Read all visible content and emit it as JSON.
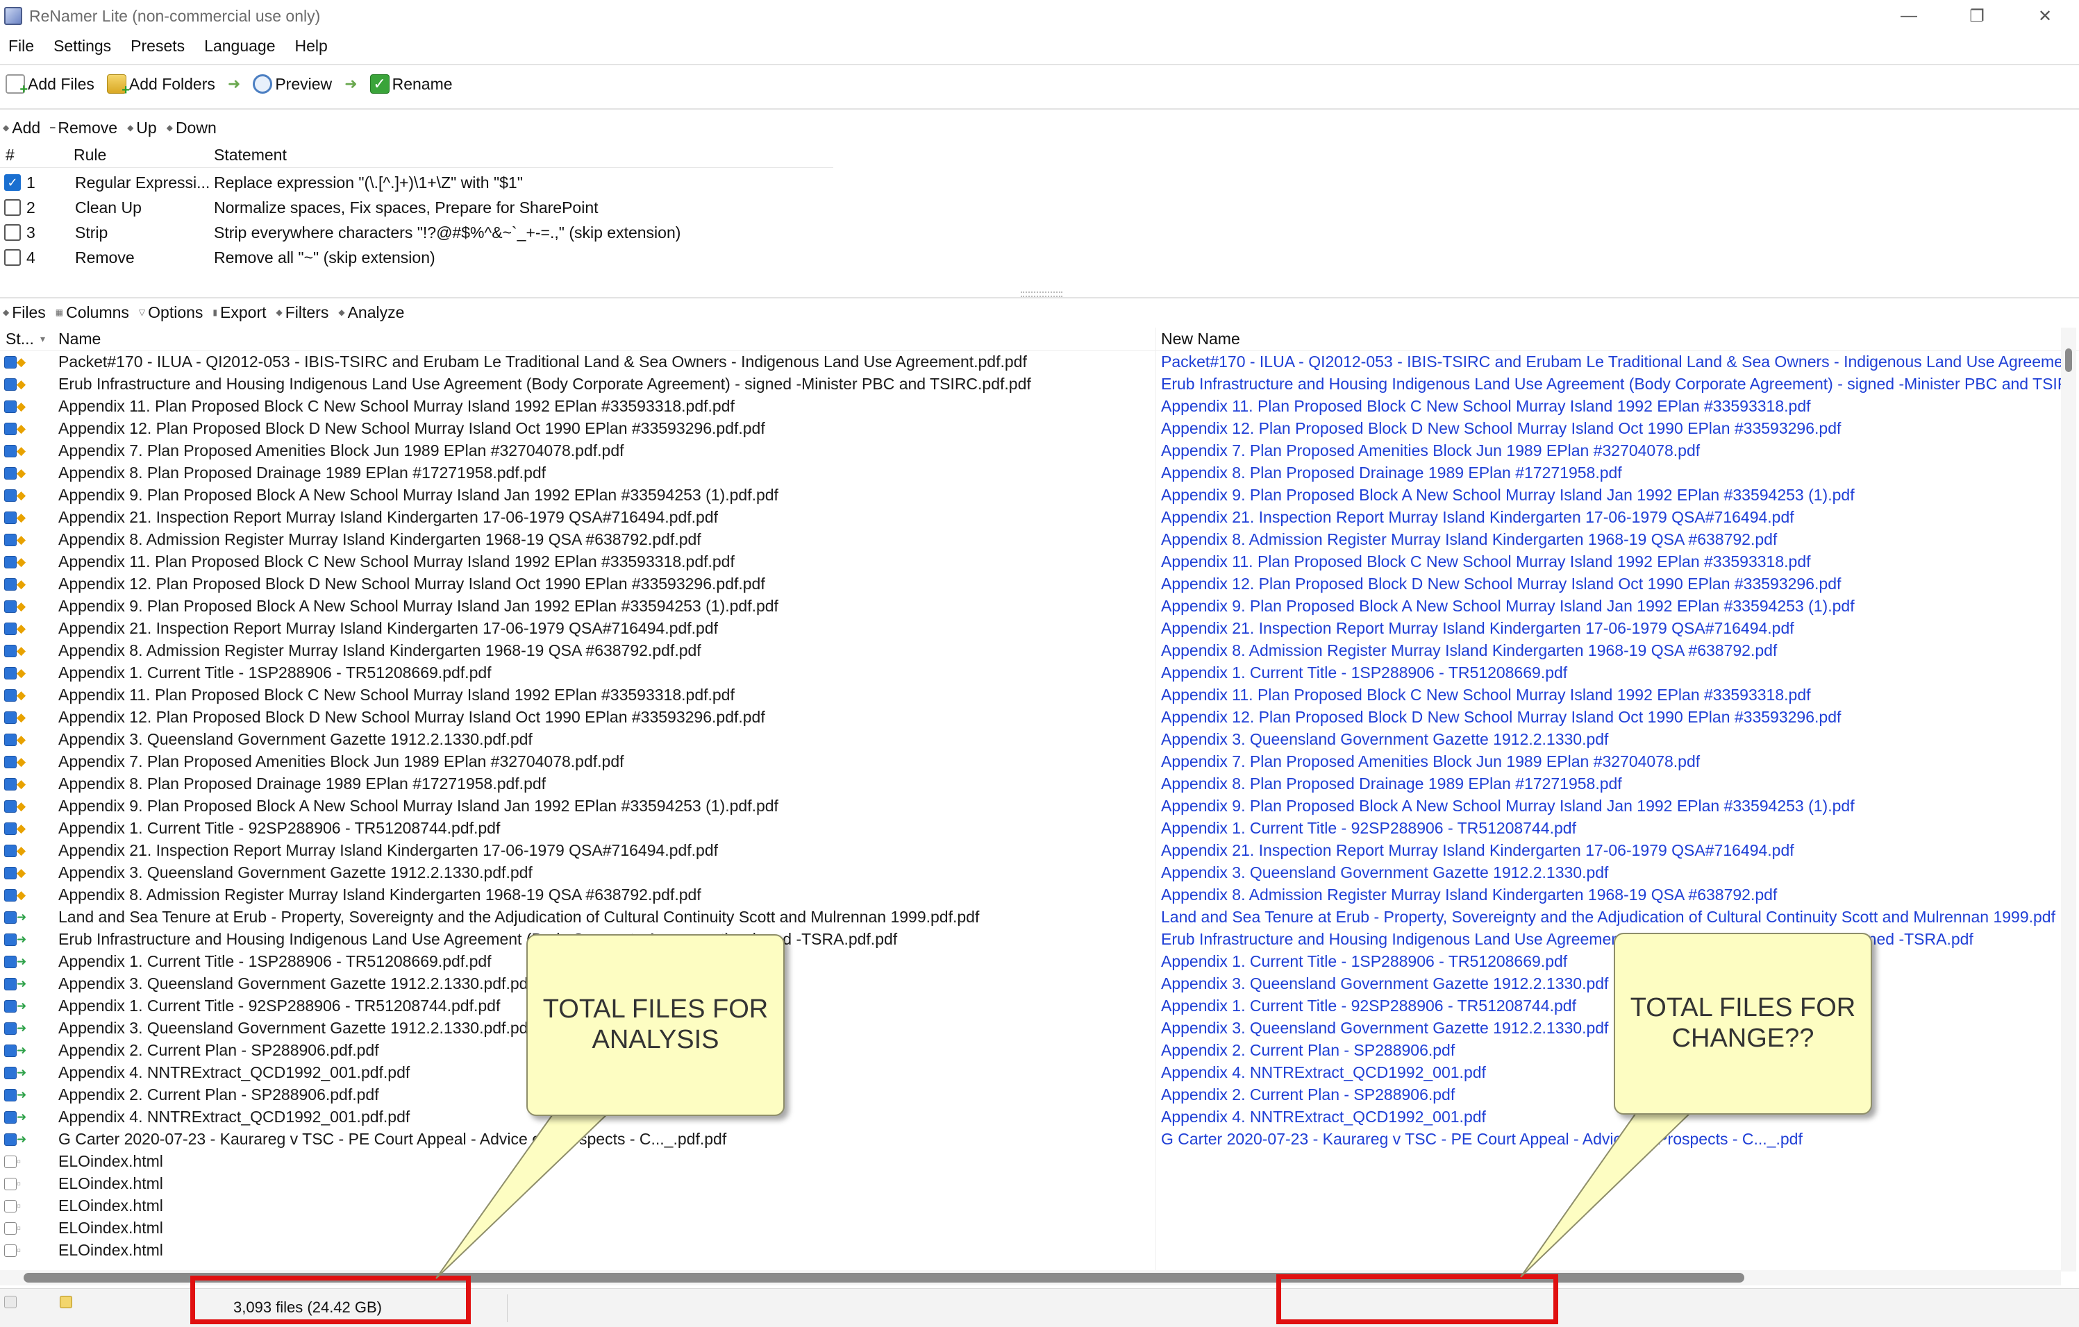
{
  "window": {
    "title": "ReNamer Lite (non-commercial use only)",
    "controls": [
      "—",
      "❐",
      "✕"
    ]
  },
  "menu": [
    "File",
    "Settings",
    "Presets",
    "Language",
    "Help"
  ],
  "toolbar": {
    "add_files": "Add Files",
    "add_folders": "Add Folders",
    "preview": "Preview",
    "rename": "Rename"
  },
  "rules_tools": [
    "Add",
    "Remove",
    "Up",
    "Down"
  ],
  "rules_header": {
    "num": "#",
    "rule": "Rule",
    "statement": "Statement"
  },
  "rules": [
    {
      "checked": true,
      "num": "1",
      "rule": "Regular Expressi...",
      "statement": "Replace expression \"(\\.[^.]+)\\1+\\Z\" with \"$1\""
    },
    {
      "checked": false,
      "num": "2",
      "rule": "Clean Up",
      "statement": "Normalize spaces, Fix spaces, Prepare for SharePoint"
    },
    {
      "checked": false,
      "num": "3",
      "rule": "Strip",
      "statement": "Strip everywhere characters \"!?@#$%^&~`_+-=.,\" (skip extension)"
    },
    {
      "checked": false,
      "num": "4",
      "rule": "Remove",
      "statement": "Remove all \"~\" (skip extension)"
    }
  ],
  "files_tools": [
    "Files",
    "Columns",
    "Options",
    "Export",
    "Filters",
    "Analyze"
  ],
  "grid_header": {
    "state": "St...",
    "name": "Name",
    "new_name": "New Name"
  },
  "files": [
    {
      "s": "c",
      "b": "diamond",
      "name": "Packet#170 - ILUA - QI2012-053 - IBIS-TSIRC and Erubam Le Traditional Land & Sea Owners - Indigenous Land Use Agreement.pdf.pdf",
      "new": "Packet#170 - ILUA - QI2012-053 - IBIS-TSIRC and Erubam Le Traditional Land & Sea Owners - Indigenous Land Use Agreement.pdf"
    },
    {
      "s": "c",
      "b": "diamond",
      "name": "Erub Infrastructure and Housing Indigenous Land Use Agreement (Body Corporate Agreement) - signed -Minister PBC and TSIRC.pdf.pdf",
      "new": "Erub Infrastructure and Housing Indigenous Land Use Agreement (Body Corporate Agreement) - signed -Minister PBC and TSIRC.pdf"
    },
    {
      "s": "c",
      "b": "diamond",
      "name": "Appendix 11. Plan Proposed Block C New School Murray Island 1992 EPlan #33593318.pdf.pdf",
      "new": "Appendix 11. Plan Proposed Block C New School Murray Island 1992 EPlan #33593318.pdf"
    },
    {
      "s": "c",
      "b": "diamond",
      "name": "Appendix 12. Plan Proposed Block D New School Murray Island Oct 1990 EPlan #33593296.pdf.pdf",
      "new": "Appendix 12. Plan Proposed Block D New School Murray Island Oct 1990 EPlan #33593296.pdf"
    },
    {
      "s": "c",
      "b": "diamond",
      "name": "Appendix 7. Plan Proposed Amenities Block Jun 1989 EPlan #32704078.pdf.pdf",
      "new": "Appendix 7. Plan Proposed Amenities Block Jun 1989 EPlan #32704078.pdf"
    },
    {
      "s": "c",
      "b": "diamond",
      "name": "Appendix 8. Plan Proposed Drainage 1989 EPlan #17271958.pdf.pdf",
      "new": "Appendix 8. Plan Proposed Drainage 1989 EPlan #17271958.pdf"
    },
    {
      "s": "c",
      "b": "diamond",
      "name": "Appendix 9. Plan Proposed Block A New School Murray Island Jan 1992 EPlan #33594253 (1).pdf.pdf",
      "new": "Appendix 9. Plan Proposed Block A New School Murray Island Jan 1992 EPlan #33594253 (1).pdf"
    },
    {
      "s": "c",
      "b": "diamond",
      "name": "Appendix 21. Inspection Report Murray Island Kindergarten 17-06-1979 QSA#716494.pdf.pdf",
      "new": "Appendix 21. Inspection Report Murray Island Kindergarten 17-06-1979 QSA#716494.pdf"
    },
    {
      "s": "c",
      "b": "diamond",
      "name": "Appendix 8. Admission Register Murray Island Kindergarten 1968-19 QSA #638792.pdf.pdf",
      "new": "Appendix 8. Admission Register Murray Island Kindergarten 1968-19 QSA #638792.pdf"
    },
    {
      "s": "c",
      "b": "diamond",
      "name": "Appendix 11. Plan Proposed Block C New School Murray Island 1992 EPlan #33593318.pdf.pdf",
      "new": "Appendix 11. Plan Proposed Block C New School Murray Island 1992 EPlan #33593318.pdf"
    },
    {
      "s": "c",
      "b": "diamond",
      "name": "Appendix 12. Plan Proposed Block D New School Murray Island Oct 1990 EPlan #33593296.pdf.pdf",
      "new": "Appendix 12. Plan Proposed Block D New School Murray Island Oct 1990 EPlan #33593296.pdf"
    },
    {
      "s": "c",
      "b": "diamond",
      "name": "Appendix 9. Plan Proposed Block A New School Murray Island Jan 1992 EPlan #33594253 (1).pdf.pdf",
      "new": "Appendix 9. Plan Proposed Block A New School Murray Island Jan 1992 EPlan #33594253 (1).pdf"
    },
    {
      "s": "c",
      "b": "diamond",
      "name": "Appendix 21. Inspection Report Murray Island Kindergarten 17-06-1979 QSA#716494.pdf.pdf",
      "new": "Appendix 21. Inspection Report Murray Island Kindergarten 17-06-1979 QSA#716494.pdf"
    },
    {
      "s": "c",
      "b": "diamond",
      "name": "Appendix 8. Admission Register Murray Island Kindergarten 1968-19 QSA #638792.pdf.pdf",
      "new": "Appendix 8. Admission Register Murray Island Kindergarten 1968-19 QSA #638792.pdf"
    },
    {
      "s": "c",
      "b": "diamond",
      "name": "Appendix 1. Current Title - 1SP288906 - TR51208669.pdf.pdf",
      "new": "Appendix 1. Current Title - 1SP288906 - TR51208669.pdf"
    },
    {
      "s": "c",
      "b": "diamond",
      "name": "Appendix 11. Plan Proposed Block C New School Murray Island 1992 EPlan #33593318.pdf.pdf",
      "new": "Appendix 11. Plan Proposed Block C New School Murray Island 1992 EPlan #33593318.pdf"
    },
    {
      "s": "c",
      "b": "diamond",
      "name": "Appendix 12. Plan Proposed Block D New School Murray Island Oct 1990 EPlan #33593296.pdf.pdf",
      "new": "Appendix 12. Plan Proposed Block D New School Murray Island Oct 1990 EPlan #33593296.pdf"
    },
    {
      "s": "c",
      "b": "diamond",
      "name": "Appendix 3. Queensland Government Gazette 1912.2.1330.pdf.pdf",
      "new": "Appendix 3. Queensland Government Gazette 1912.2.1330.pdf"
    },
    {
      "s": "c",
      "b": "diamond",
      "name": "Appendix 7. Plan Proposed Amenities Block Jun 1989 EPlan #32704078.pdf.pdf",
      "new": "Appendix 7. Plan Proposed Amenities Block Jun 1989 EPlan #32704078.pdf"
    },
    {
      "s": "c",
      "b": "diamond",
      "name": "Appendix 8. Plan Proposed Drainage 1989 EPlan #17271958.pdf.pdf",
      "new": "Appendix 8. Plan Proposed Drainage 1989 EPlan #17271958.pdf"
    },
    {
      "s": "c",
      "b": "diamond",
      "name": "Appendix 9. Plan Proposed Block A New School Murray Island Jan 1992 EPlan #33594253 (1).pdf.pdf",
      "new": "Appendix 9. Plan Proposed Block A New School Murray Island Jan 1992 EPlan #33594253 (1).pdf"
    },
    {
      "s": "c",
      "b": "diamond",
      "name": "Appendix 1. Current Title - 92SP288906 - TR51208744.pdf.pdf",
      "new": "Appendix 1. Current Title - 92SP288906 - TR51208744.pdf"
    },
    {
      "s": "c",
      "b": "diamond",
      "name": "Appendix 21. Inspection Report Murray Island Kindergarten 17-06-1979 QSA#716494.pdf.pdf",
      "new": "Appendix 21. Inspection Report Murray Island Kindergarten 17-06-1979 QSA#716494.pdf"
    },
    {
      "s": "c",
      "b": "diamond",
      "name": "Appendix 3. Queensland Government Gazette 1912.2.1330.pdf.pdf",
      "new": "Appendix 3. Queensland Government Gazette 1912.2.1330.pdf"
    },
    {
      "s": "c",
      "b": "diamond",
      "name": "Appendix 8. Admission Register Murray Island Kindergarten 1968-19 QSA #638792.pdf.pdf",
      "new": "Appendix 8. Admission Register Murray Island Kindergarten 1968-19 QSA #638792.pdf"
    },
    {
      "s": "c",
      "b": "arrow",
      "name": "Land and Sea Tenure at Erub - Property, Sovereignty and the Adjudication of Cultural Continuity Scott and Mulrennan 1999.pdf.pdf",
      "new": "Land and Sea Tenure at Erub - Property, Sovereignty and the Adjudication of Cultural Continuity Scott and Mulrennan 1999.pdf"
    },
    {
      "s": "c",
      "b": "arrow",
      "name": "Erub Infrastructure and Housing Indigenous Land Use Agreement (Body Corporate Agreement) - signed -TSRA.pdf.pdf",
      "new": "Erub Infrastructure and Housing Indigenous Land Use Agreement (Body Corporate Agreement) - signed -TSRA.pdf"
    },
    {
      "s": "c",
      "b": "arrow",
      "name": "Appendix 1. Current Title - 1SP288906 - TR51208669.pdf.pdf",
      "new": "Appendix 1. Current Title - 1SP288906 - TR51208669.pdf"
    },
    {
      "s": "c",
      "b": "arrow",
      "name": "Appendix 3. Queensland Government Gazette 1912.2.1330.pdf.pdf",
      "new": "Appendix 3. Queensland Government Gazette 1912.2.1330.pdf"
    },
    {
      "s": "c",
      "b": "arrow",
      "name": "Appendix 1. Current Title - 92SP288906 - TR51208744.pdf.pdf",
      "new": "Appendix 1. Current Title - 92SP288906 - TR51208744.pdf"
    },
    {
      "s": "c",
      "b": "arrow",
      "name": "Appendix 3. Queensland Government Gazette 1912.2.1330.pdf.pdf",
      "new": "Appendix 3. Queensland Government Gazette 1912.2.1330.pdf"
    },
    {
      "s": "c",
      "b": "arrow",
      "name": "Appendix 2. Current Plan - SP288906.pdf.pdf",
      "new": "Appendix 2. Current Plan - SP288906.pdf"
    },
    {
      "s": "c",
      "b": "arrow",
      "name": "Appendix 4. NNTRExtract_QCD1992_001.pdf.pdf",
      "new": "Appendix 4. NNTRExtract_QCD1992_001.pdf"
    },
    {
      "s": "c",
      "b": "arrow",
      "name": "Appendix 2. Current Plan - SP288906.pdf.pdf",
      "new": "Appendix 2. Current Plan - SP288906.pdf"
    },
    {
      "s": "c",
      "b": "arrow",
      "name": "Appendix 4. NNTRExtract_QCD1992_001.pdf.pdf",
      "new": "Appendix 4. NNTRExtract_QCD1992_001.pdf"
    },
    {
      "s": "c",
      "b": "arrow",
      "name": "G Carter 2020-07-23 - Kaurareg v TSC - PE Court Appeal - Advice on Prospects - C..._.pdf.pdf",
      "new": "G Carter 2020-07-23 - Kaurareg v TSC - PE Court Appeal - Advice on Prospects - C..._.pdf"
    },
    {
      "s": "u",
      "b": "doc",
      "name": "ELOindex.html",
      "new": ""
    },
    {
      "s": "u",
      "b": "doc",
      "name": "ELOindex.html",
      "new": ""
    },
    {
      "s": "u",
      "b": "doc",
      "name": "ELOindex.html",
      "new": ""
    },
    {
      "s": "u",
      "b": "doc",
      "name": "ELOindex.html",
      "new": ""
    },
    {
      "s": "u",
      "b": "doc",
      "name": "ELOindex.html",
      "new": ""
    }
  ],
  "status": {
    "files_summary": "3,093 files (24.42 GB)"
  },
  "annotations": {
    "left_callout": "TOTAL FILES FOR\nANALYSIS",
    "right_callout": "TOTAL FILES FOR\nCHANGE??",
    "highlight_color": "#e01010",
    "callout_fill": "#fdfdc2"
  },
  "colors": {
    "new_name": "#1f3fd6",
    "checkbox_on": "#1a6fd0"
  }
}
